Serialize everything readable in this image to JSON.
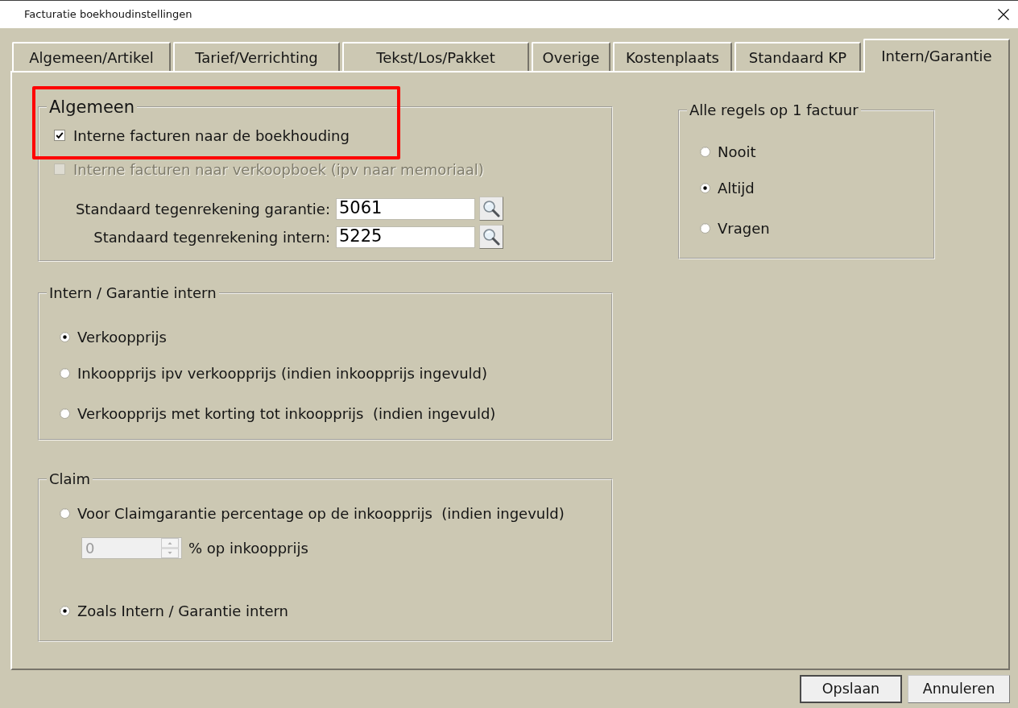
{
  "window": {
    "title": "Facturatie boekhoudinstellingen"
  },
  "tabs": [
    {
      "label": "Algemeen/Artikel",
      "selected": false
    },
    {
      "label": "Tarief/Verrichting",
      "selected": false
    },
    {
      "label": "Tekst/Los/Pakket",
      "selected": false
    },
    {
      "label": "Overige",
      "selected": false
    },
    {
      "label": "Kostenplaats",
      "selected": false
    },
    {
      "label": "Standaard KP",
      "selected": false
    },
    {
      "label": "Intern/Garantie",
      "selected": true
    }
  ],
  "algemeen": {
    "title": "Algemeen",
    "highlighted": true,
    "checkboxes": [
      {
        "label": "Interne facturen naar de boekhouding",
        "checked": true,
        "disabled": false
      },
      {
        "label": "Interne facturen naar verkoopboek (ipv naar memoriaal)",
        "checked": false,
        "disabled": true
      }
    ],
    "fields": [
      {
        "label": "Standaard tegenrekening garantie:",
        "value": "5061"
      },
      {
        "label": "Standaard tegenrekening intern:",
        "value": "5225"
      }
    ]
  },
  "intern_garantie": {
    "title": "Intern / Garantie intern",
    "options": [
      {
        "label": "Verkoopprijs",
        "selected": true
      },
      {
        "label": "Inkoopprijs ipv verkoopprijs (indien inkoopprijs ingevuld)",
        "selected": false
      },
      {
        "label": "Verkoopprijs met korting tot inkoopprijs  (indien ingevuld)",
        "selected": false
      }
    ]
  },
  "claim": {
    "title": "Claim",
    "options": [
      {
        "label": "Voor Claimgarantie percentage op de inkoopprijs  (indien ingevuld)",
        "selected": false
      },
      {
        "label": "Zoals Intern / Garantie intern",
        "selected": true
      }
    ],
    "percentage": {
      "value": "0",
      "disabled": true,
      "unit": "% op inkoopprijs"
    }
  },
  "alle_regels": {
    "title": "Alle regels op 1 factuur",
    "options": [
      {
        "label": "Nooit",
        "selected": false
      },
      {
        "label": "Altijd",
        "selected": true
      },
      {
        "label": "Vragen",
        "selected": false
      }
    ]
  },
  "buttons": [
    {
      "label": "Opslaan",
      "default": true
    },
    {
      "label": "Annuleren",
      "default": false
    }
  ]
}
